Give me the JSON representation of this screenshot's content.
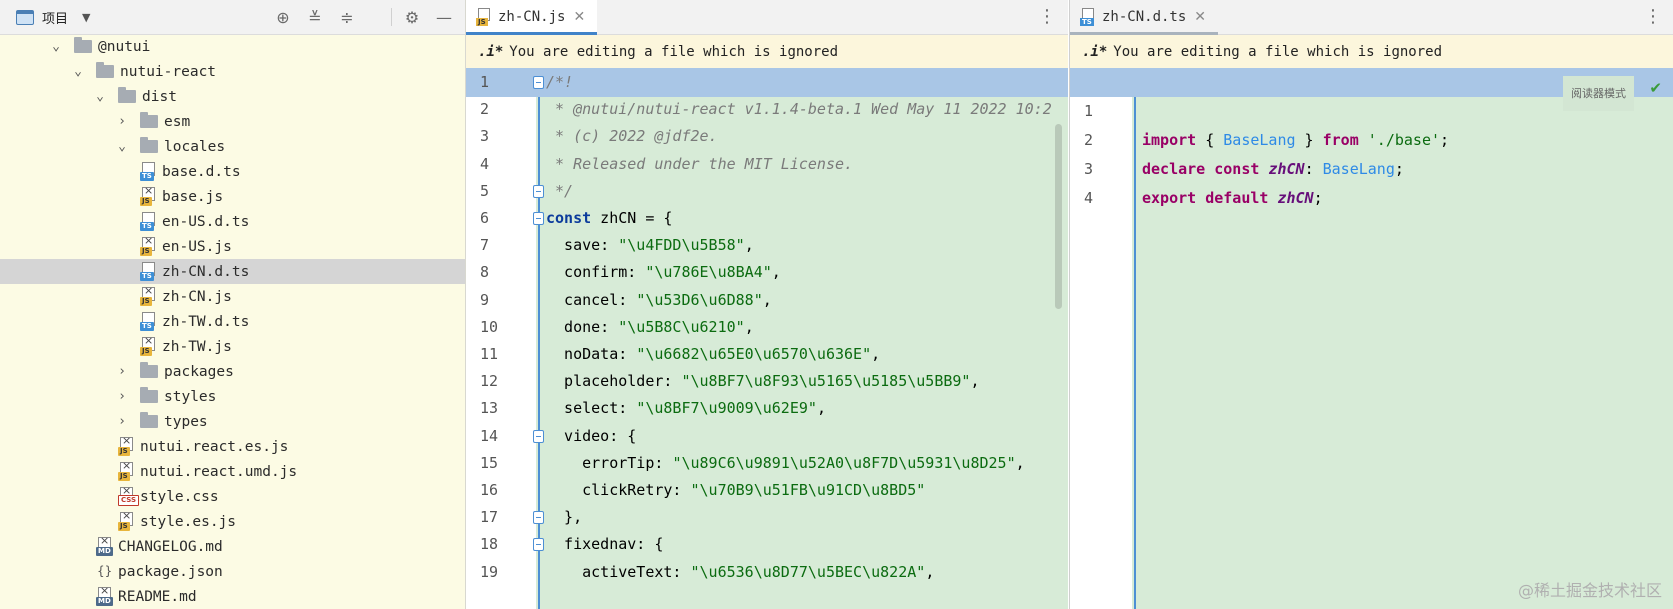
{
  "project_panel": {
    "title": "项目",
    "toolbar_icons": [
      "locate-icon",
      "expand-all-icon",
      "collapse-all-icon",
      "settings-icon",
      "minimize-icon"
    ],
    "tree": [
      {
        "label": "@nutui",
        "kind": "folder",
        "depth": 0,
        "expanded": true
      },
      {
        "label": "nutui-react",
        "kind": "folder",
        "depth": 1,
        "expanded": true
      },
      {
        "label": "dist",
        "kind": "folder",
        "depth": 2,
        "expanded": true
      },
      {
        "label": "esm",
        "kind": "folder",
        "depth": 3,
        "expanded": false
      },
      {
        "label": "locales",
        "kind": "folder",
        "depth": 3,
        "expanded": true
      },
      {
        "label": "base.d.ts",
        "kind": "ts",
        "depth": 4
      },
      {
        "label": "base.js",
        "kind": "js",
        "depth": 4
      },
      {
        "label": "en-US.d.ts",
        "kind": "ts",
        "depth": 4
      },
      {
        "label": "en-US.js",
        "kind": "js",
        "depth": 4
      },
      {
        "label": "zh-CN.d.ts",
        "kind": "ts",
        "depth": 4,
        "selected": true
      },
      {
        "label": "zh-CN.js",
        "kind": "js",
        "depth": 4
      },
      {
        "label": "zh-TW.d.ts",
        "kind": "ts",
        "depth": 4
      },
      {
        "label": "zh-TW.js",
        "kind": "js",
        "depth": 4
      },
      {
        "label": "packages",
        "kind": "folder",
        "depth": 3,
        "expanded": false
      },
      {
        "label": "styles",
        "kind": "folder",
        "depth": 3,
        "expanded": false
      },
      {
        "label": "types",
        "kind": "folder",
        "depth": 3,
        "expanded": false
      },
      {
        "label": "nutui.react.es.js",
        "kind": "js",
        "depth": 3
      },
      {
        "label": "nutui.react.umd.js",
        "kind": "js",
        "depth": 3
      },
      {
        "label": "style.css",
        "kind": "css",
        "depth": 3
      },
      {
        "label": "style.es.js",
        "kind": "js",
        "depth": 3
      },
      {
        "label": "CHANGELOG.md",
        "kind": "md",
        "depth": 2
      },
      {
        "label": "package.json",
        "kind": "json",
        "depth": 2
      },
      {
        "label": "README.md",
        "kind": "md",
        "depth": 2
      }
    ]
  },
  "editor_left": {
    "tab": {
      "label": "zh-CN.js",
      "badge": "JS"
    },
    "banner": {
      "icon": ".i*",
      "text": "You are editing a file which is ignored"
    },
    "close_label": "关闭",
    "lines": [
      {
        "n": "1",
        "text": "/*!"
      },
      {
        "n": "2",
        "text": " * @nutui/nutui-react v1.1.4-beta.1 Wed May 11 2022 10:2"
      },
      {
        "n": "3",
        "text": " * (c) 2022 @jdf2e."
      },
      {
        "n": "4",
        "text": " * Released under the MIT License."
      },
      {
        "n": "5",
        "text": " */"
      },
      {
        "n": "6",
        "text": "const zhCN = {"
      },
      {
        "n": "7",
        "text": "  save: \"\\u4FDD\\u5B58\","
      },
      {
        "n": "8",
        "text": "  confirm: \"\\u786E\\u8BA4\","
      },
      {
        "n": "9",
        "text": "  cancel: \"\\u53D6\\u6D88\","
      },
      {
        "n": "10",
        "text": "  done: \"\\u5B8C\\u6210\","
      },
      {
        "n": "11",
        "text": "  noData: \"\\u6682\\u65E0\\u6570\\u636E\","
      },
      {
        "n": "12",
        "text": "  placeholder: \"\\u8BF7\\u8F93\\u5165\\u5185\\u5BB9\","
      },
      {
        "n": "13",
        "text": "  select: \"\\u8BF7\\u9009\\u62E9\","
      },
      {
        "n": "14",
        "text": "  video: {"
      },
      {
        "n": "15",
        "text": "    errorTip: \"\\u89C6\\u9891\\u52A0\\u8F7D\\u5931\\u8D25\","
      },
      {
        "n": "16",
        "text": "    clickRetry: \"\\u70B9\\u51FB\\u91CD\\u8BD5\""
      },
      {
        "n": "17",
        "text": "  },"
      },
      {
        "n": "18",
        "text": "  fixednav: {"
      },
      {
        "n": "19",
        "text": "    activeText: \"\\u6536\\u8D77\\u5BEC\\u822A\","
      }
    ]
  },
  "editor_right": {
    "tab": {
      "label": "zh-CN.d.ts",
      "badge": "TS"
    },
    "banner": {
      "icon": ".i*",
      "text": "You are editing a file which is ignored"
    },
    "reader_mode_label": "阅读器模式",
    "lines": [
      {
        "n": "1"
      },
      {
        "n": "2"
      },
      {
        "n": "3"
      },
      {
        "n": "4"
      }
    ],
    "code": {
      "l1_kw": "import",
      "l1_brace_open": " { ",
      "l1_type": "BaseLang",
      "l1_brace_close": " } ",
      "l1_from": "from",
      "l1_str": " './base'",
      "l1_end": ";",
      "l2_kw1": "declare",
      "l2_kw2": " const ",
      "l2_id": "zhCN",
      "l2_colon": ": ",
      "l2_type": "BaseLang",
      "l2_end": ";",
      "l3_kw1": "export",
      "l3_kw2": " default ",
      "l3_id": "zhCN",
      "l3_end": ";"
    }
  },
  "watermark": "@稀土掘金技术社区",
  "colors": {
    "accent": "#4083c9",
    "diff_green": "#d7ebd7",
    "current_line": "#a9c6e6",
    "banner": "#fcf6dc",
    "project_bg": "#fcfbe4"
  }
}
